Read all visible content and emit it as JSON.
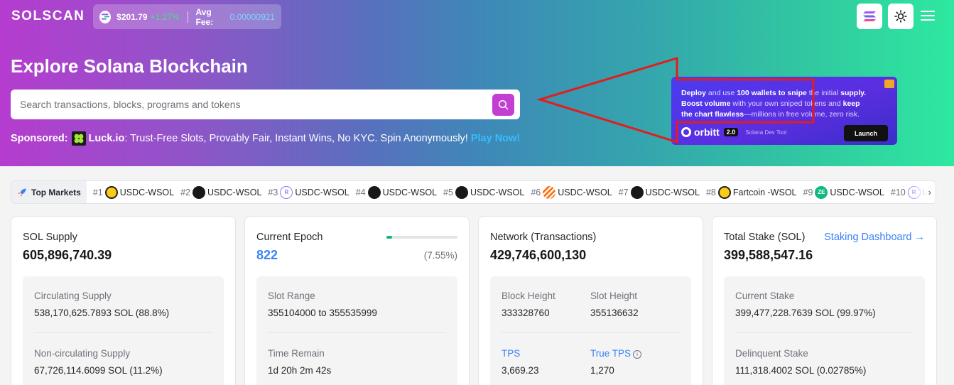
{
  "header": {
    "logo": "SOLSCAN",
    "price": "$201.79",
    "price_change": "+1.27%",
    "avg_fee_label": "Avg Fee:",
    "avg_fee_value": "0.00000921"
  },
  "hero": {
    "title": "Explore Solana Blockchain",
    "search_placeholder": "Search transactions, blocks, programs and tokens",
    "sponsored_label": "Sponsored:",
    "sponsored_brand": "Luck.io",
    "sponsored_text": ": Trust-Free Slots, Provably Fair, Instant Wins, No KYC. Spin Anonymously!",
    "sponsored_cta": "Play Now!"
  },
  "ad": {
    "line1_a": "Deploy",
    "line1_b": " and use ",
    "line1_c": "100 wallets to snipe",
    "line1_d": " the initial ",
    "line1_e": "supply.",
    "line2_a": "Boost volume",
    "line2_b": " with your own sniped tokens and ",
    "line2_c": "keep",
    "line3_a": "the chart flawless",
    "line3_b": "—millions in free volume, zero risk.",
    "brand": "orbitt",
    "version": "2.0",
    "tagline": "Solana Dev Tool",
    "launch": "Launch"
  },
  "markets": {
    "label": "Top Markets",
    "items": [
      {
        "rank": "#1",
        "pair": "USDC-WSOL",
        "icon": "ic-yellow"
      },
      {
        "rank": "#2",
        "pair": "USDC-WSOL",
        "icon": "ic-black"
      },
      {
        "rank": "#3",
        "pair": "USDC-WSOL",
        "icon": "ic-ray"
      },
      {
        "rank": "#4",
        "pair": "USDC-WSOL",
        "icon": "ic-black"
      },
      {
        "rank": "#5",
        "pair": "USDC-WSOL",
        "icon": "ic-black"
      },
      {
        "rank": "#6",
        "pair": "USDC-WSOL",
        "icon": "ic-stripe"
      },
      {
        "rank": "#7",
        "pair": "USDC-WSOL",
        "icon": "ic-black"
      },
      {
        "rank": "#8",
        "pair": "Fartcoin -WSOL",
        "icon": "ic-yellow"
      },
      {
        "rank": "#9",
        "pair": "USDC-WSOL",
        "icon": "ic-ze"
      },
      {
        "rank": "#10",
        "pair": "USDC-WS",
        "icon": "ic-ray"
      }
    ]
  },
  "cards": {
    "supply": {
      "title": "SOL Supply",
      "value": "605,896,740.39",
      "circ_label": "Circulating Supply",
      "circ_value": "538,170,625.7893 SOL (88.8%)",
      "noncirc_label": "Non-circulating Supply",
      "noncirc_value": "67,726,114.6099 SOL (11.2%)"
    },
    "epoch": {
      "title": "Current Epoch",
      "value": "822",
      "progress_pct": 7.55,
      "pct_text": "(7.55%)",
      "slot_range_label": "Slot Range",
      "slot_range_value": "355104000 to 355535999",
      "time_label": "Time Remain",
      "time_value": "1d 20h 2m 42s"
    },
    "network": {
      "title": "Network (Transactions)",
      "value": "429,746,600,130",
      "block_label": "Block Height",
      "block_value": "333328760",
      "slot_label": "Slot Height",
      "slot_value": "355136632",
      "tps_label": "TPS",
      "tps_value": "3,669.23",
      "true_tps_label": "True TPS",
      "true_tps_value": "1,270"
    },
    "stake": {
      "title": "Total Stake (SOL)",
      "link": "Staking Dashboard →",
      "value": "399,588,547.16",
      "current_label": "Current Stake",
      "current_value": "399,477,228.7639 SOL (99.97%)",
      "delinquent_label": "Delinquent Stake",
      "delinquent_value": "111,318.4002 SOL (0.02785%)"
    }
  },
  "colors": {
    "accent": "#c23fd2",
    "link": "#3b82f6",
    "positive": "#4ade80",
    "annotation": "#e11d1d"
  }
}
